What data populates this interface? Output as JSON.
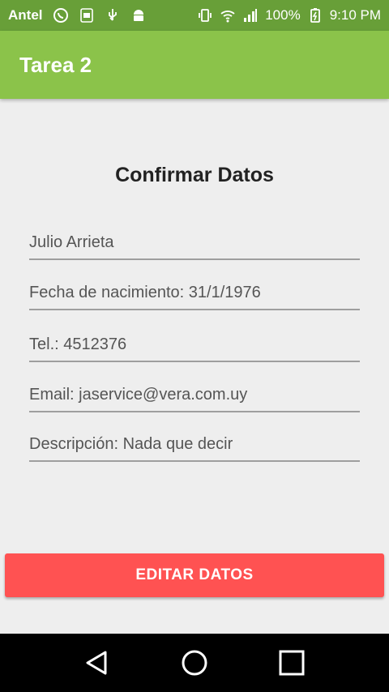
{
  "status_bar": {
    "carrier": "Antel",
    "battery": "100%",
    "time": "9:10 PM",
    "icons": [
      "whatsapp-icon",
      "badge-100-icon",
      "usb-icon",
      "android-icon",
      "vibrate-icon",
      "wifi-icon",
      "signal-icon",
      "battery-charging-icon"
    ]
  },
  "app_bar": {
    "title": "Tarea 2"
  },
  "main": {
    "heading": "Confirmar Datos",
    "fields": [
      "Julio Arrieta",
      "Fecha de nacimiento: 31/1/1976",
      "Tel.: 4512376",
      "Email: jaservice@vera.com.uy",
      "Descripción: Nada que decir"
    ],
    "edit_button": "EDITAR DATOS"
  },
  "colors": {
    "status_bar": "#689f38",
    "app_bar": "#8bc34a",
    "button": "#ff5252",
    "background": "#eeeeee"
  }
}
